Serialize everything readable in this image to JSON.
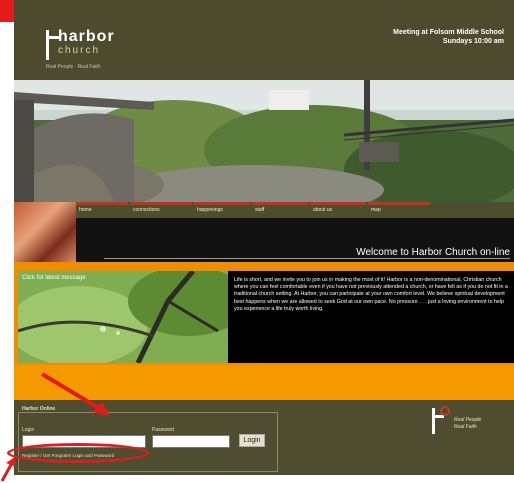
{
  "header": {
    "logo_name": "harbor",
    "logo_sub": "church",
    "logo_tagline": "Real People · Real Faith",
    "meeting_line1": "Meeting at Folsom Middle School",
    "meeting_line2": "Sundays 10:00 am"
  },
  "nav": {
    "items": [
      {
        "label": "home"
      },
      {
        "label": "connections"
      },
      {
        "label": "happenings"
      },
      {
        "label": "staff"
      },
      {
        "label": "about us"
      },
      {
        "label": "map"
      }
    ]
  },
  "welcome": "Welcome to Harbor Church on-line",
  "message": {
    "label": "Click for latest message",
    "intro": "Life is short, and we invite you to join us in making the most of it! Harbor is a non-denominational, Christian church where you can feel comfortable even if you have not previously attended a church, or have felt as if you do not fit in a traditional church setting. At Harbor, you can participate at your own comfort level. We believe spiritual development best happens when we are allowed to seek God at our own pace. No pressure . . . just a loving environment to help you experience a life truly worth living."
  },
  "login": {
    "heading": "Harbor Online",
    "login_label": "Login",
    "password_label": "Password",
    "login_value": "",
    "password_value": "",
    "button_label": "Login",
    "register_link": "Register / Get Forgotten Login and Password"
  },
  "footer_logo": {
    "line1": "Real People",
    "line2": "Real Faith"
  },
  "colors": {
    "olive": "#4e4d2f",
    "orange": "#f08c00",
    "annotation_red": "#e31b1b"
  }
}
